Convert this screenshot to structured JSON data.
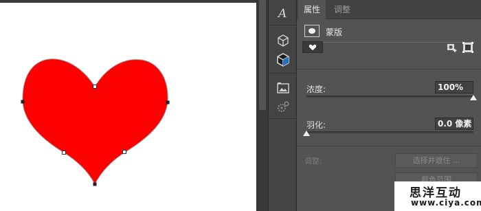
{
  "canvas": {
    "shape_fill": "#ff0000",
    "background": "#ffffff"
  },
  "toolstrip": {
    "icons": [
      "character-panel-icon",
      "3d-cube-icon",
      "3d-cube-dark-icon",
      "image-adjust-icon",
      "gear-cluster-icon"
    ]
  },
  "panel": {
    "tabs": [
      {
        "label": "属性"
      },
      {
        "label": "调整"
      }
    ],
    "mask_title": "蒙版",
    "density": {
      "label": "浓度:",
      "value": "100%",
      "level": 1.0
    },
    "feather": {
      "label": "羽化:",
      "value": "0.0 像素",
      "level": 0.0
    },
    "adjust_label": "调整:",
    "select_mask_button": "选择并遮住 ...",
    "color_range_button": "颜色范围"
  },
  "watermark": {
    "title": "思洋互动",
    "url": "www.ciya.com"
  },
  "colors": {
    "panel_bg": "#535353",
    "tab_bg": "#424242",
    "accent_red": "#ff0000"
  }
}
